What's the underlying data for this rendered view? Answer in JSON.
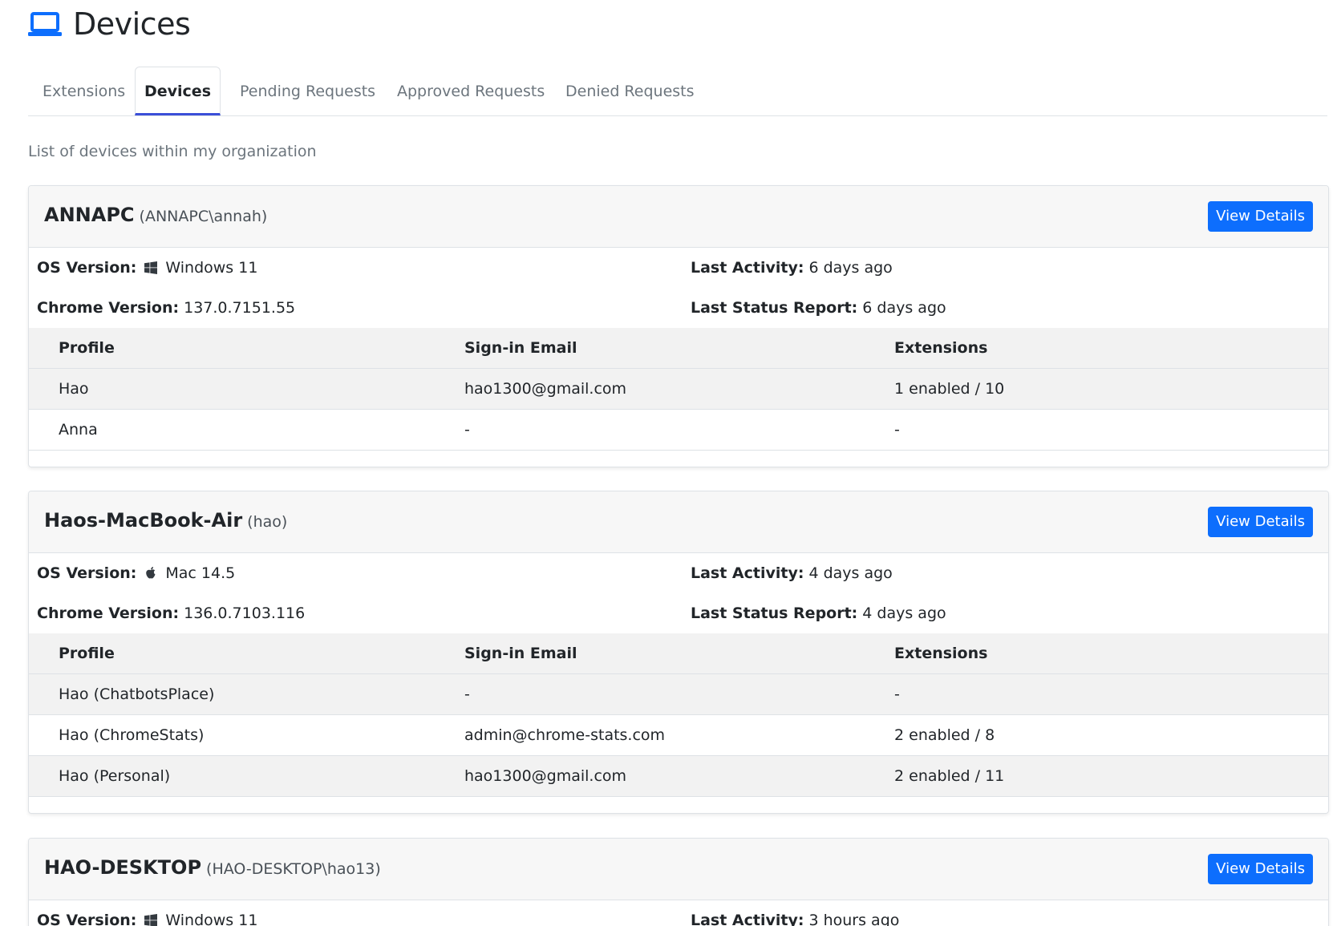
{
  "page": {
    "title": "Devices",
    "icon": "laptop-icon",
    "accent_color": "#0d6efd",
    "subtitle": "List of devices within my organization"
  },
  "tabs": [
    {
      "label": "Extensions",
      "active": false
    },
    {
      "label": "Devices",
      "active": true
    },
    {
      "label": "Pending Requests",
      "active": false
    },
    {
      "label": "Approved Requests",
      "active": false
    },
    {
      "label": "Denied Requests",
      "active": false
    }
  ],
  "labels": {
    "os_version": "OS Version:",
    "chrome_version": "Chrome Version:",
    "last_activity": "Last Activity:",
    "last_status_report": "Last Status Report:",
    "view_details": "View Details",
    "col_profile": "Profile",
    "col_email": "Sign-in Email",
    "col_extensions": "Extensions"
  },
  "devices": [
    {
      "name": "ANNAPC",
      "user": "(ANNAPC\\annah)",
      "os_icon": "windows-icon",
      "os": "Windows 11",
      "chrome_version": "137.0.7151.55",
      "last_activity": "6 days ago",
      "last_status_report": "6 days ago",
      "profiles": [
        {
          "profile": "Hao",
          "email": "hao1300@gmail.com",
          "extensions": "1 enabled / 10"
        },
        {
          "profile": "Anna",
          "email": "-",
          "extensions": "-"
        }
      ]
    },
    {
      "name": "Haos-MacBook-Air",
      "user": "(hao)",
      "os_icon": "apple-icon",
      "os": "Mac 14.5",
      "chrome_version": "136.0.7103.116",
      "last_activity": "4 days ago",
      "last_status_report": "4 days ago",
      "profiles": [
        {
          "profile": "Hao (ChatbotsPlace)",
          "email": "-",
          "extensions": "-"
        },
        {
          "profile": "Hao (ChromeStats)",
          "email": "admin@chrome-stats.com",
          "extensions": "2 enabled / 8"
        },
        {
          "profile": "Hao (Personal)",
          "email": "hao1300@gmail.com",
          "extensions": "2 enabled / 11"
        }
      ]
    },
    {
      "name": "HAO-DESKTOP",
      "user": "(HAO-DESKTOP\\hao13)",
      "os_icon": "windows-icon",
      "os": "Windows 11",
      "last_activity": "3 hours ago"
    }
  ]
}
